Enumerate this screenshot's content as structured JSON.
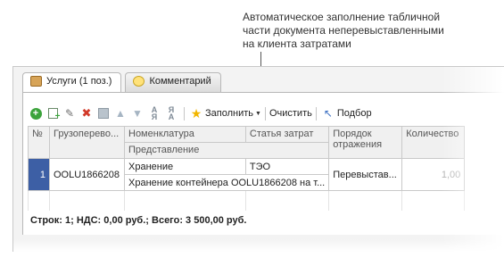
{
  "callout": {
    "text": "Автоматическое заполнение табличной\nчасти документа неперевыставленными\nна клиента затратами"
  },
  "tabs": [
    {
      "label": "Услуги (1 поз.)",
      "icon": "briefcase-icon",
      "active": true
    },
    {
      "label": "Комментарий",
      "icon": "comment-icon",
      "active": false
    }
  ],
  "toolbar": {
    "fill_label": "Заполнить",
    "clear_label": "Очистить",
    "select_label": "Подбор"
  },
  "table": {
    "headers": {
      "num": "№",
      "cargo": "Грузоперево...",
      "nomenclature": "Номенклатура",
      "representation": "Представление",
      "cost_item": "Статья затрат",
      "reflection": "Порядок отражения",
      "quantity": "Количество"
    },
    "rows": [
      {
        "num": "1",
        "cargo": "OOLU1866208",
        "nomenclature": "Хранение",
        "representation": "Хранение контейнера OOLU1866208 на т...",
        "cost_item": "ТЭО",
        "reflection": "Перевыстав...",
        "quantity": "1,00"
      }
    ]
  },
  "footer": {
    "summary": "Строк: 1; НДС: 0,00 руб.; Всего: 3 500,00 руб."
  },
  "colors": {
    "selected_cell": "#3d5fa5",
    "add_icon": "#3ba33b",
    "delete_icon": "#d23a2a",
    "star_icon": "#f2b600"
  }
}
